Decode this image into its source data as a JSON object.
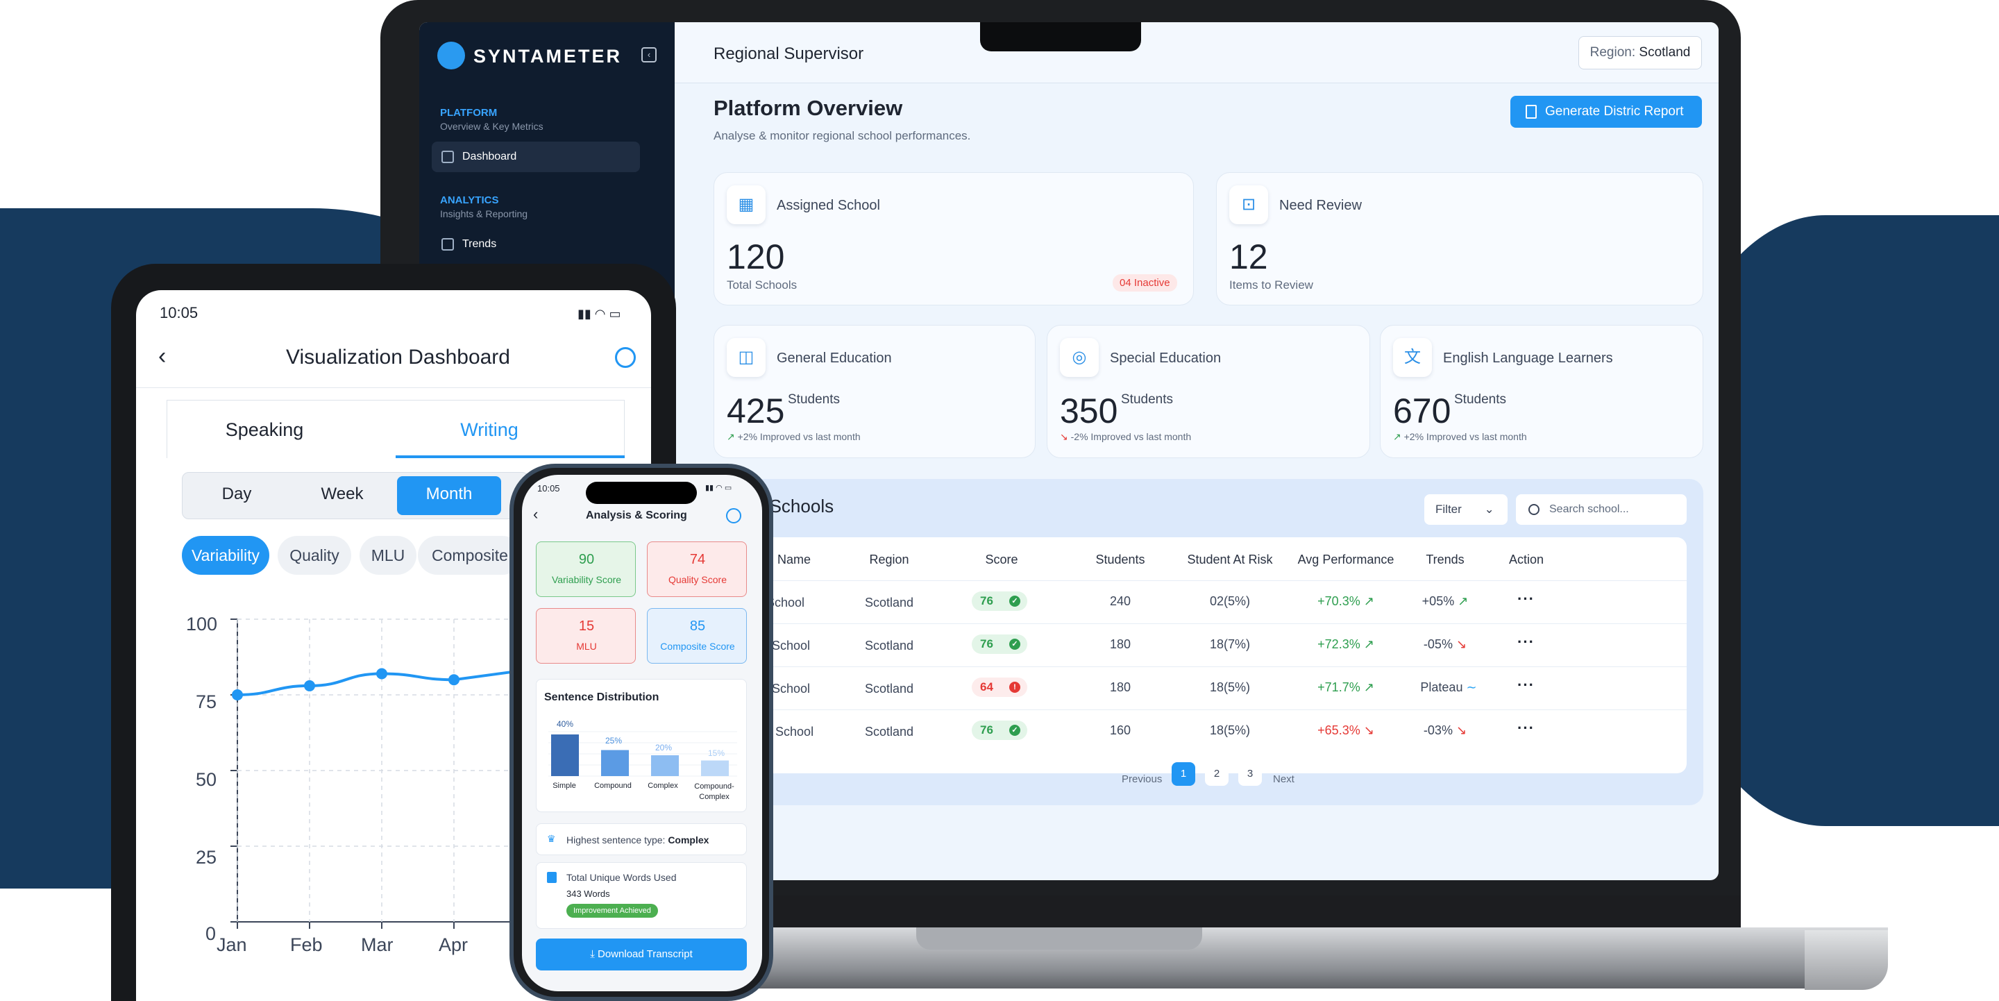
{
  "brand": {
    "name": "SYNTAMETER",
    "accent": "#2196f3",
    "dark": "#0f1c2e",
    "blob": "#163a5e"
  },
  "sidebar": {
    "sections": [
      {
        "title": "PLATFORM",
        "subtitle": "Overview & Key Metrics",
        "items": [
          {
            "label": "Dashboard",
            "icon": "grid-icon",
            "active": true
          }
        ]
      },
      {
        "title": "ANALYTICS",
        "subtitle": "Insights & Reporting",
        "items": [
          {
            "label": "Trends",
            "icon": "chart-icon",
            "active": false
          }
        ]
      }
    ]
  },
  "header": {
    "role": "Regional Supervisor",
    "region_label": "Region:",
    "region_value": "Scotland"
  },
  "overview": {
    "title": "Platform Overview",
    "subtitle": "Analyse & monitor regional school performances.",
    "generate_button": "Generate Distric Report"
  },
  "cards": {
    "assigned": {
      "label": "Assigned School",
      "value": "120",
      "caption": "Total Schools",
      "badge": "04 Inactive"
    },
    "review": {
      "label": "Need Review",
      "value": "12",
      "caption": "Items to Review"
    },
    "general": {
      "label": "General Education",
      "value": "425",
      "unit": "Students",
      "change": "+2% Improved vs last month"
    },
    "special": {
      "label": "Special Education",
      "value": "350",
      "unit": "Students",
      "change": "-2% Improved vs last month"
    },
    "ell": {
      "label": "English Language Learners",
      "value": "670",
      "unit": "Students",
      "change": "+2% Improved vs last month"
    }
  },
  "schools": {
    "title": "List of Schools",
    "filter": "Filter",
    "search_placeholder": "Search school...",
    "columns": [
      "School Name",
      "Region",
      "Score",
      "Students",
      "Student At Risk",
      "Avg Performance",
      "Trends",
      "Action"
    ],
    "rows": [
      {
        "name": "Elite School",
        "region": "Scotland",
        "score": "76",
        "status": "good",
        "students": "240",
        "risk": "02(5%)",
        "perf": "+70.3%",
        "perf_dir": "up",
        "trend": "+05%",
        "trend_dir": "up"
      },
      {
        "name": "Prime School",
        "region": "Scotland",
        "score": "76",
        "status": "good",
        "students": "180",
        "risk": "18(7%)",
        "perf": "+72.3%",
        "perf_dir": "up",
        "trend": "-05%",
        "trend_dir": "down"
      },
      {
        "name": "Spark School",
        "region": "Scotland",
        "score": "64",
        "status": "warn",
        "students": "180",
        "risk": "18(5%)",
        "perf": "+71.7%",
        "perf_dir": "up",
        "trend": "Plateau",
        "trend_dir": "flat"
      },
      {
        "name": "Kinder School",
        "region": "Scotland",
        "score": "76",
        "status": "good",
        "students": "160",
        "risk": "18(5%)",
        "perf": "+65.3%",
        "perf_dir": "down",
        "trend": "-03%",
        "trend_dir": "down"
      }
    ],
    "pagination": {
      "previous": "Previous",
      "pages": [
        "1",
        "2",
        "3"
      ],
      "current": "1",
      "next": "Next"
    }
  },
  "tablet": {
    "time": "10:05",
    "title": "Visualization Dashboard",
    "tabs": [
      "Speaking",
      "Writing"
    ],
    "active_tab": "Writing",
    "ranges": [
      "Day",
      "Week",
      "Month"
    ],
    "active_range": "Month",
    "metrics": [
      "Variability",
      "Quality",
      "MLU",
      "Composite"
    ],
    "active_metric": "Variability",
    "chart_data": {
      "type": "line",
      "x": [
        "Jan",
        "Feb",
        "Mar",
        "Apr"
      ],
      "series": [
        {
          "values": [
            75,
            78,
            82,
            80
          ]
        }
      ],
      "ylim": [
        0,
        100
      ],
      "yticks": [
        0,
        25,
        50,
        75,
        100
      ],
      "grid": true
    }
  },
  "phone": {
    "time": "10:05",
    "title": "Analysis & Scoring",
    "scores": [
      {
        "value": "90",
        "label": "Variability Score",
        "tone": "green"
      },
      {
        "value": "74",
        "label": "Quality Score",
        "tone": "red"
      },
      {
        "value": "15",
        "label": "MLU",
        "tone": "red"
      },
      {
        "value": "85",
        "label": "Composite Score",
        "tone": "blue"
      }
    ],
    "distribution": {
      "title": "Sentence Distribution",
      "chart_data": {
        "type": "bar",
        "categories": [
          "Simple",
          "Compound",
          "Complex",
          "Compound-Complex"
        ],
        "values": [
          40,
          25,
          20,
          15
        ],
        "labels": [
          "40%",
          "25%",
          "20%",
          "15%"
        ]
      }
    },
    "highest": {
      "label": "Highest sentence type:",
      "value": "Complex"
    },
    "unique": {
      "title": "Total Unique Words Used",
      "value": "343 Words",
      "badge": "Improvement Achieved"
    },
    "download": "Download Transcript"
  }
}
